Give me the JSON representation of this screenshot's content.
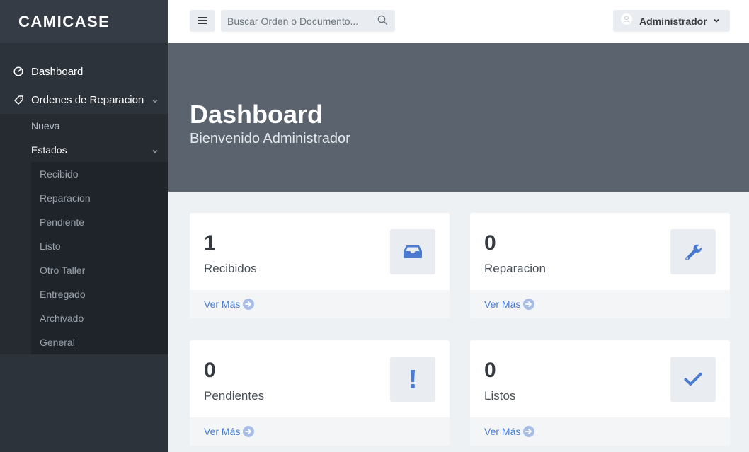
{
  "brand": {
    "name": "CAMICASE"
  },
  "sidebar": {
    "items": [
      {
        "label": "Dashboard",
        "icon": "gauge-icon"
      },
      {
        "label": "Ordenes de Reparacion",
        "icon": "tag-icon",
        "expanded": true
      }
    ],
    "sub": [
      {
        "label": "Nueva"
      },
      {
        "label": "Estados",
        "expanded": true
      }
    ],
    "estados": [
      "Recibido",
      "Reparacion",
      "Pendiente",
      "Listo",
      "Otro Taller",
      "Entregado",
      "Archivado",
      "General"
    ]
  },
  "header": {
    "search_placeholder": "Buscar Orden o Documento...",
    "user_label": "Administrador"
  },
  "hero": {
    "title": "Dashboard",
    "subtitle": "Bienvenido Administrador"
  },
  "cards": [
    {
      "count": "1",
      "label": "Recibidos",
      "more": "Ver Más",
      "icon": "inbox-icon"
    },
    {
      "count": "0",
      "label": "Reparacion",
      "more": "Ver Más",
      "icon": "wrench-icon"
    },
    {
      "count": "0",
      "label": "Pendientes",
      "more": "Ver Más",
      "icon": "exclamation-icon"
    },
    {
      "count": "0",
      "label": "Listos",
      "more": "Ver Más",
      "icon": "check-icon"
    }
  ],
  "colors": {
    "accent": "#4a7bd0",
    "sidebar": "#2d333b",
    "hero": "#5b646e"
  }
}
